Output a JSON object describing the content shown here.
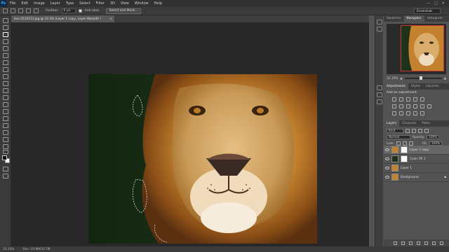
{
  "app": {
    "logo": "Ps"
  },
  "menu": [
    "File",
    "Edit",
    "Image",
    "Layer",
    "Type",
    "Select",
    "Filter",
    "3D",
    "View",
    "Window",
    "Help"
  ],
  "window_controls": [
    "—",
    "□",
    "✕"
  ],
  "options": {
    "feather_label": "Feather:",
    "feather_value": "0 px",
    "antialias_label": "Anti-alias",
    "select_mask_button": "Select and Mask...",
    "workspace": "Essentials"
  },
  "document": {
    "tab_title": "lion-3510113.jpg @ 33.3% (Layer 1 copy, Layer Mask/8) *",
    "close": "×"
  },
  "status": {
    "zoom": "33.33%",
    "doc": "Doc: 10.9M/33.7M"
  },
  "panels": {
    "top_tabs": [
      "Swatches",
      "Navigator",
      "Histogram"
    ],
    "navigator_zoom": "33.33%",
    "mid_tabs": [
      "Adjustments",
      "Styles",
      "Libraries"
    ],
    "adjustments_title": "Add an adjustment",
    "layer_tabs": [
      "Layers",
      "Channels",
      "Paths"
    ],
    "kind_label": "Kind",
    "blend_mode": "Normal",
    "opacity_label": "Opacity:",
    "opacity_value": "100%",
    "lock_label": "Lock:",
    "fill_label": "Fill:",
    "fill_value": "100%",
    "layers": [
      {
        "name": "Layer 1 copy",
        "selected": true
      },
      {
        "name": "Color Fill 1",
        "selected": false
      },
      {
        "name": "Layer 1",
        "selected": false
      },
      {
        "name": "Background",
        "selected": false
      }
    ]
  },
  "colors": {
    "accent": "#31a8ff",
    "canvas_bg": "#1d3219",
    "lion_mane": "#c88a3c",
    "lion_face": "#d8a866"
  }
}
